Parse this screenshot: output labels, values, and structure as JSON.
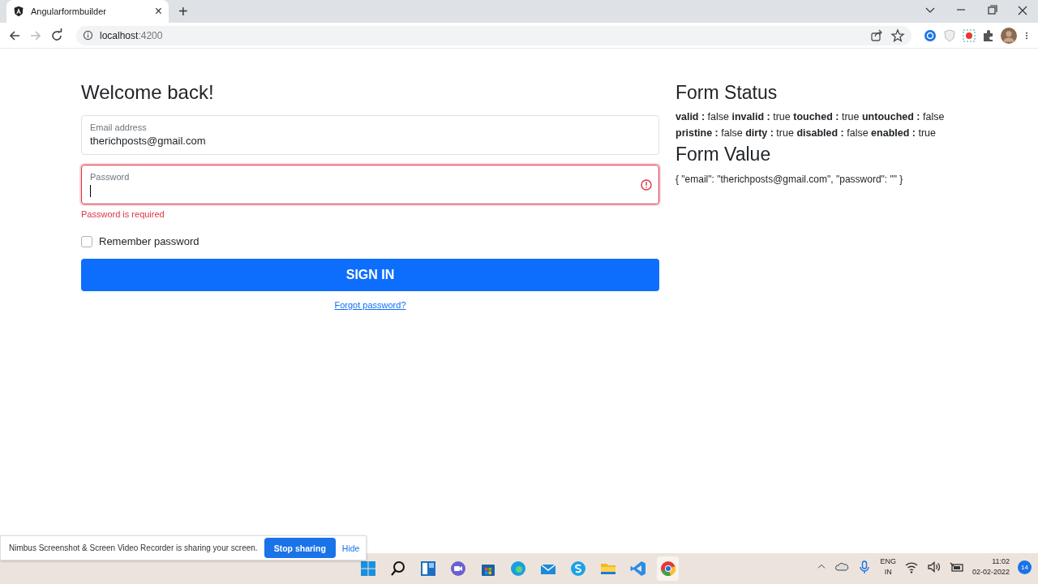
{
  "browser": {
    "tab_title": "Angularformbuilder",
    "tab_close": "×",
    "new_tab": "+",
    "url_host": "localhost",
    "url_port": ":4200"
  },
  "form": {
    "title": "Welcome back!",
    "fields": [
      {
        "label": "Email address",
        "value": "therichposts@gmail.com",
        "invalid": false
      },
      {
        "label": "Password",
        "invalid": true,
        "error": "Password is required"
      }
    ],
    "remember": {
      "label": "Remember password",
      "checked": false
    },
    "submit": "SIGN IN",
    "forgot": "Forgot password?"
  },
  "status": {
    "title": "Form Status",
    "lines": [
      "**valid :** false **invalid :** true **touched :** true **untouched :** false",
      "**pristine :** false **dirty :** true **disabled :** false **enabled :** true"
    ],
    "value_title": "Form Value",
    "value": "{ \"email\": \"therichposts@gmail.com\", \"password\": \"\" }"
  },
  "share_bar": {
    "message": "Nimbus Screenshot & Screen Video Recorder is sharing your screen.",
    "stop": "Stop sharing",
    "hide": "Hide"
  },
  "taskbar": {
    "lang": "ENG",
    "region": "IN",
    "time": "11:02",
    "date": "02-02-2022",
    "notifications": "14"
  }
}
